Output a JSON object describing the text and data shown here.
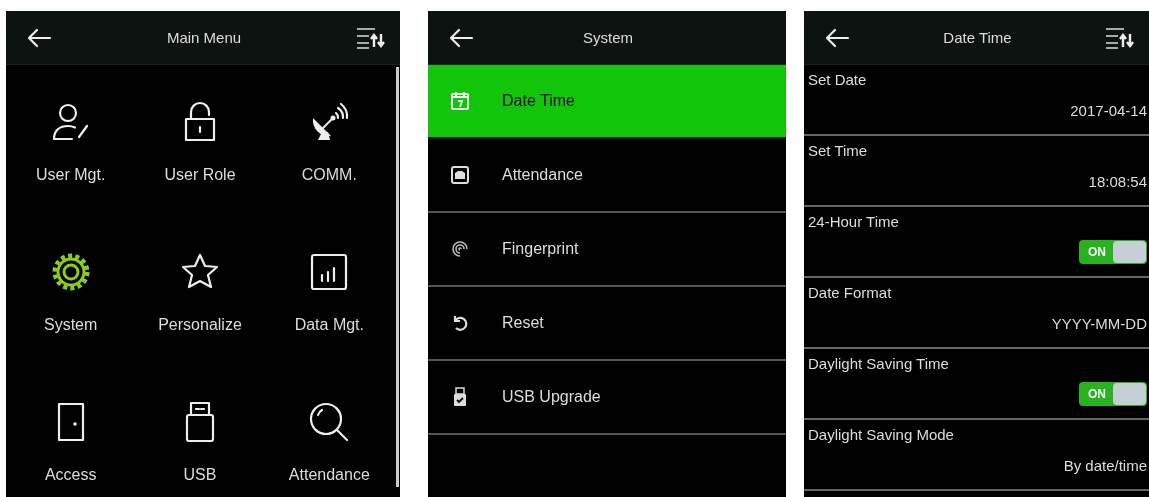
{
  "screens": [
    {
      "kind": "grid",
      "title": "Main Menu",
      "sort_button": true,
      "items": [
        {
          "label": "User Mgt.",
          "selected": false
        },
        {
          "label": "User Role",
          "selected": false
        },
        {
          "label": "COMM.",
          "selected": false
        },
        {
          "label": "System",
          "selected": true
        },
        {
          "label": "Personalize",
          "selected": false
        },
        {
          "label": "Data Mgt.",
          "selected": false
        },
        {
          "label": "Access",
          "selected": false
        },
        {
          "label": "USB",
          "selected": false
        },
        {
          "label": "Attendance",
          "selected": false
        }
      ]
    },
    {
      "kind": "list",
      "title": "System",
      "sort_button": false,
      "items": [
        {
          "label": "Date Time",
          "selected": true
        },
        {
          "label": "Attendance",
          "selected": false
        },
        {
          "label": "Fingerprint",
          "selected": false
        },
        {
          "label": "Reset",
          "selected": false
        },
        {
          "label": "USB Upgrade",
          "selected": false
        }
      ]
    },
    {
      "kind": "settings",
      "title": "Date Time",
      "sort_button": true,
      "items": [
        {
          "kind": "value",
          "label": "Set Date",
          "value": "2017-04-14"
        },
        {
          "kind": "value",
          "label": "Set Time",
          "value": "18:08:54"
        },
        {
          "kind": "toggle",
          "label": "24-Hour Time",
          "on": true,
          "toggle_text": "ON"
        },
        {
          "kind": "value",
          "label": "Date Format",
          "value": "YYYY-MM-DD"
        },
        {
          "kind": "toggle",
          "label": "Daylight Saving Time",
          "on": true,
          "toggle_text": "ON"
        },
        {
          "kind": "value",
          "label": "Daylight Saving Mode",
          "value": "By date/time"
        }
      ]
    }
  ]
}
